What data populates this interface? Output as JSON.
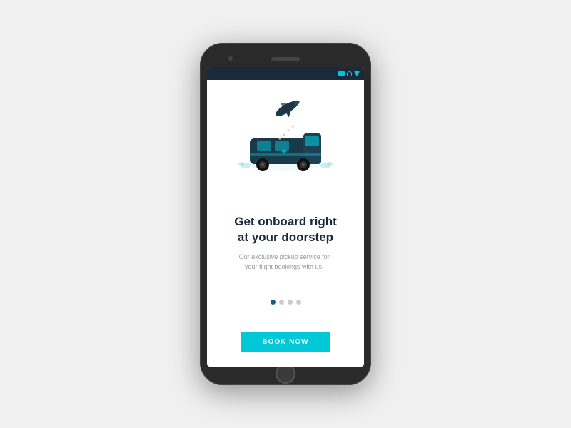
{
  "phone": {
    "statusIcons": [
      "battery",
      "wifi",
      "signal"
    ]
  },
  "screen": {
    "title": "Get onboard right\nat your doorstep",
    "subtitle": "Our exclusive pickup service for your flight bookings with us.",
    "dots": [
      {
        "active": true
      },
      {
        "active": false
      },
      {
        "active": false
      },
      {
        "active": false
      }
    ],
    "bookButton": "BOOK NOW",
    "colors": {
      "accent": "#00c8d7",
      "dark": "#1a2a3a",
      "dotActive": "#1a5f7a",
      "dotInactive": "#ccc"
    }
  }
}
